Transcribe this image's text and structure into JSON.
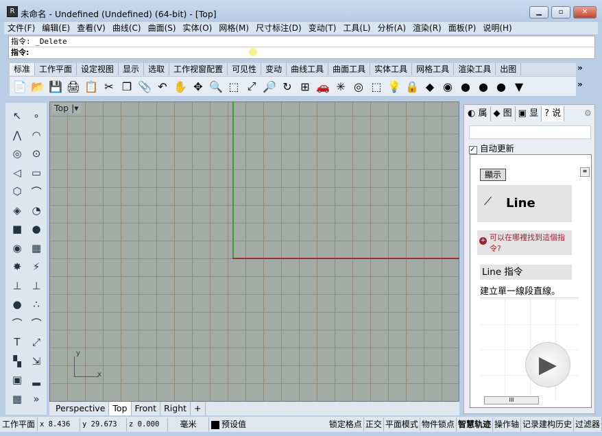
{
  "window": {
    "title": "未命名 - Undefined (Undefined) (64-bit) - [Top]"
  },
  "menu": [
    "文件(F)",
    "编辑(E)",
    "查看(V)",
    "曲线(C)",
    "曲面(S)",
    "实体(O)",
    "网格(M)",
    "尺寸标注(D)",
    "变动(T)",
    "工具(L)",
    "分析(A)",
    "渲染(R)",
    "面板(P)",
    "说明(H)"
  ],
  "command": {
    "history": "指令: _Delete",
    "prompt": "指令:"
  },
  "toolbar_tabs": [
    "标准",
    "工作平面",
    "设定视图",
    "显示",
    "选取",
    "工作视窗配置",
    "可见性",
    "变动",
    "曲线工具",
    "曲面工具",
    "实体工具",
    "网格工具",
    "渲染工具",
    "出图"
  ],
  "toolbar_icons": [
    "📄",
    "📂",
    "💾",
    "🖨",
    "📋",
    "✂",
    "❐",
    "📎",
    "↶",
    "✋",
    "✥",
    "🔍",
    "⬚",
    "⤢",
    "🔎",
    "↻",
    "⊞",
    "🚗",
    "✳",
    "◎",
    "⬚",
    "💡",
    "🔒",
    "◆",
    "◉",
    "●",
    "●",
    "●",
    "▼"
  ],
  "viewport": {
    "label": "Top",
    "axis_y": "y",
    "axis_x": "x"
  },
  "viewport_tabs": [
    "Perspective",
    "Top",
    "Front",
    "Right",
    "+"
  ],
  "right_panel": {
    "tabs": [
      "属",
      "图",
      "显",
      "说"
    ],
    "auto_update": "自动更新",
    "show_button": "顯示",
    "command_name": "Line",
    "where_link": "可以在哪裡找到這個指令?",
    "section_title": "Line 指令",
    "description": "建立單一線段直線。"
  },
  "status": {
    "cplane": "工作平面",
    "x": "x 8.436",
    "y": "y 29.673",
    "z": "z 0.000",
    "units": "毫米",
    "layer": "预设值",
    "toggles": [
      "锁定格点",
      "正交",
      "平面模式",
      "物件锁点",
      "智慧轨迹",
      "操作轴",
      "记录建构历史",
      "过滤器"
    ]
  }
}
